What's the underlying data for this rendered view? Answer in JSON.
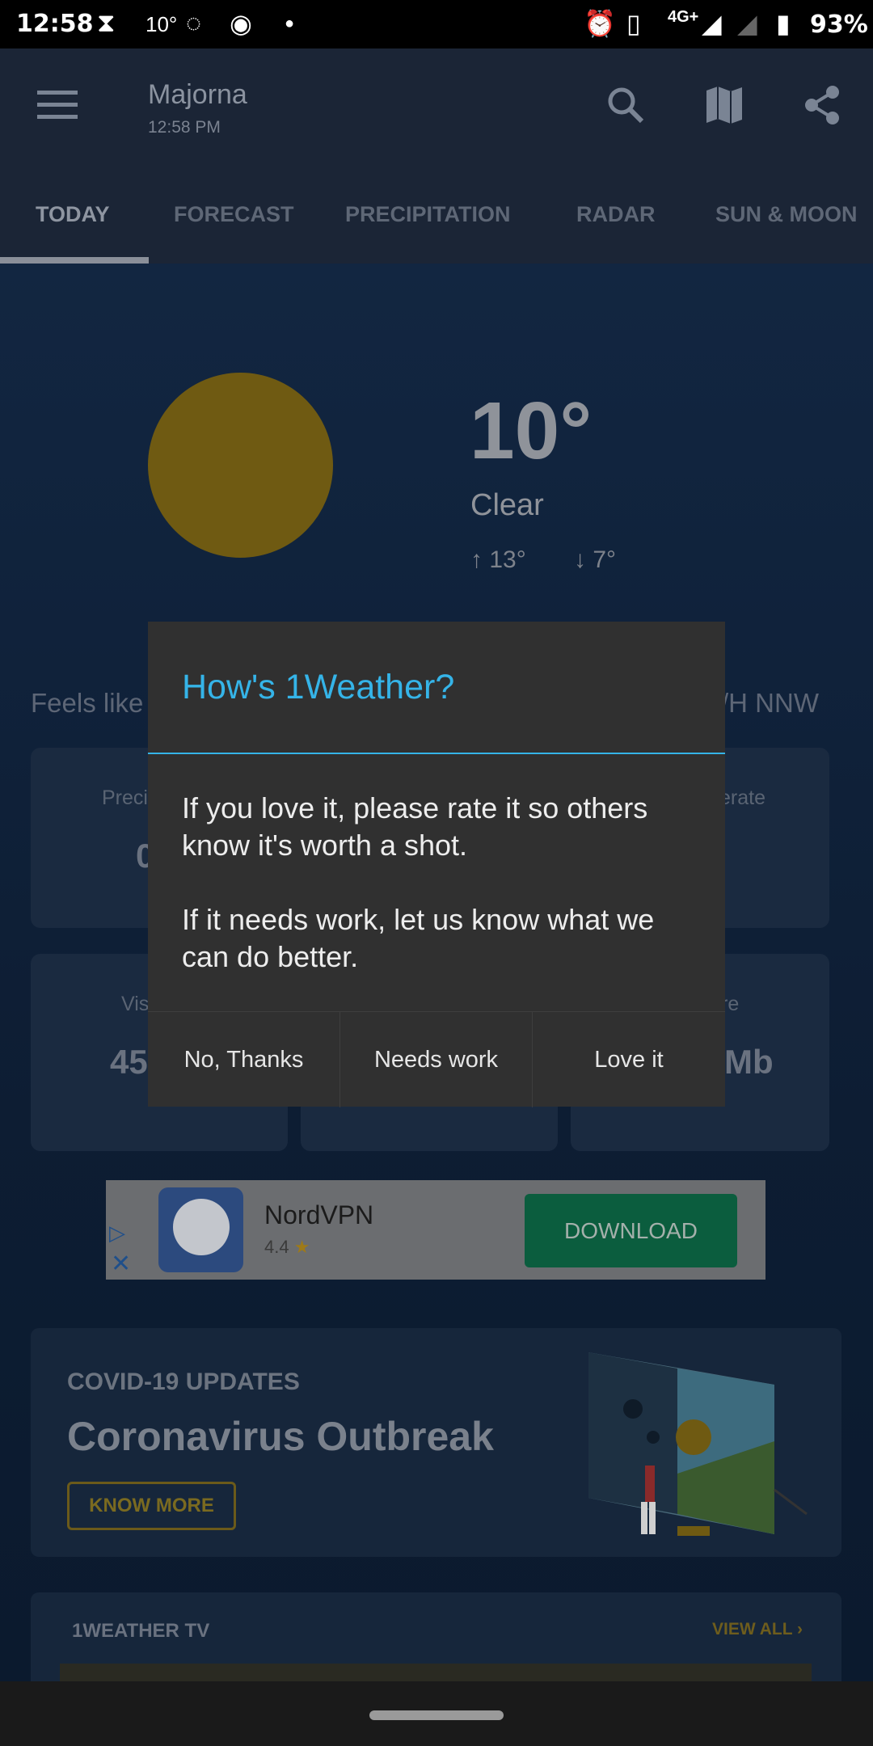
{
  "status_bar": {
    "time": "12:58",
    "temp": "10°",
    "network": "4G+",
    "battery": "93%"
  },
  "app_bar": {
    "location": "Majorna",
    "time": "12:58 PM"
  },
  "tabs": [
    "TODAY",
    "FORECAST",
    "PRECIPITATION",
    "RADAR",
    "SUN & MOON"
  ],
  "current": {
    "temp": "10°",
    "condition": "Clear",
    "high": "13°",
    "low": "7°",
    "feels_like": "Feels like",
    "wind": "/H NNW"
  },
  "cards": [
    {
      "label": "Preci",
      "value": "0"
    },
    {
      "label": "",
      "value": ""
    },
    {
      "label": "erate",
      "value": ""
    },
    {
      "label": "Vis",
      "value": "45"
    },
    {
      "label": "",
      "value": ""
    },
    {
      "label": "re",
      "value": "Mb"
    }
  ],
  "ad": {
    "app_name": "NordVPN",
    "rating": "4.4",
    "button": "DOWNLOAD"
  },
  "covid": {
    "label": "COVID-19 UPDATES",
    "title": "Coronavirus Outbreak",
    "button": "KNOW MORE"
  },
  "tv": {
    "label": "1WEATHER TV",
    "view_all": "VIEW ALL"
  },
  "dialog": {
    "title": "How's 1Weather?",
    "message": "If you love it, please rate it so others know it's worth a shot.\n\nIf it needs work, let us know what we can do better.",
    "buttons": [
      "No, Thanks",
      "Needs work",
      "Love it"
    ]
  },
  "colors": {
    "accent": "#35b4e8",
    "dialog_bg": "#303030",
    "sun": "#6f5a12"
  }
}
